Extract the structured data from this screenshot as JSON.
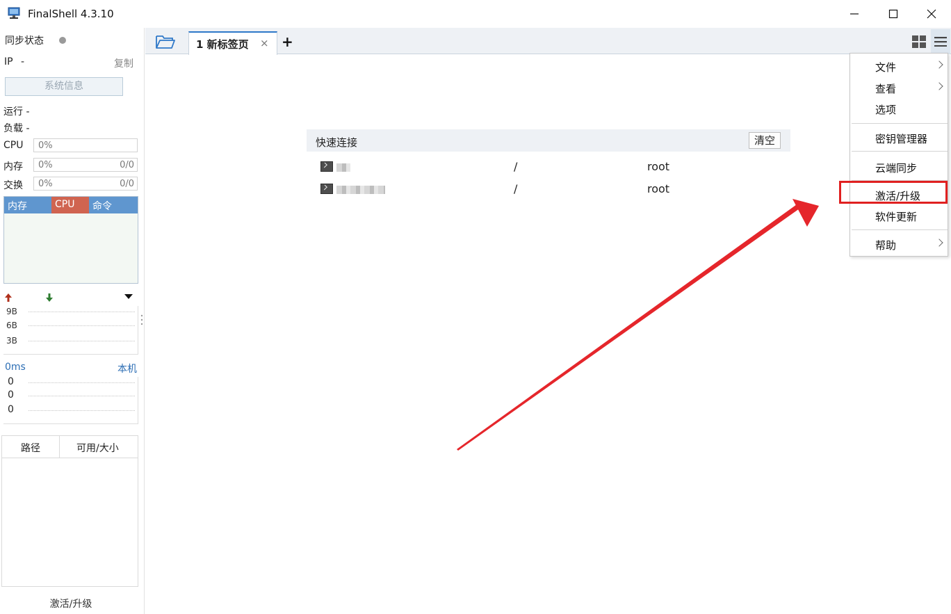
{
  "window": {
    "title": "FinalShell 4.3.10",
    "app_icon": "monitor-icon",
    "controls": [
      "minimize-icon",
      "maximize-icon",
      "close-icon"
    ]
  },
  "sidebar": {
    "sync_label": "同步状态",
    "ip_label": "IP",
    "ip_value": "-",
    "copy_label": "复制",
    "sysinfo_label": "系统信息",
    "run_label": "运行 -",
    "load_label": "负载 -",
    "cpu": {
      "label": "CPU",
      "pct": "0%"
    },
    "memory": {
      "label": "内存",
      "pct": "0%",
      "frac": "0/0"
    },
    "swap": {
      "label": "交换",
      "pct": "0%",
      "frac": "0/0"
    },
    "process_table": {
      "columns": [
        "内存",
        "CPU",
        "命令"
      ]
    },
    "network": {
      "ticks": [
        "9B",
        "6B",
        "3B"
      ],
      "icons": [
        "upload-arrow-icon",
        "download-arrow-icon",
        "dropdown-triangle-icon"
      ]
    },
    "ping": {
      "latency": "0ms",
      "target": "本机",
      "ticks": [
        "0",
        "0",
        "0"
      ]
    },
    "disk_table": {
      "columns": [
        "路径",
        "可用/大小"
      ]
    },
    "footer_activate": "激活/升级",
    "colors": {
      "proc_header": "#5f96cf",
      "proc_cpu": "#d06450",
      "link": "#2e6fb5"
    }
  },
  "tabbar": {
    "tabs": [
      {
        "label": "1 新标签页",
        "close": "×"
      }
    ],
    "add_label": "+",
    "icons": [
      "folder-open-icon",
      "grid-layout-icon",
      "hamburger-menu-icon"
    ]
  },
  "quick_connect": {
    "title": "快速连接",
    "clear_label": "清空",
    "rows": [
      {
        "path": "/",
        "user": "root"
      },
      {
        "path": "/",
        "user": "root"
      }
    ]
  },
  "menu": {
    "items": [
      {
        "label": "文件",
        "submenu": true
      },
      {
        "label": "查看",
        "submenu": true
      },
      {
        "label": "选项",
        "submenu": false
      },
      {
        "label": "密钥管理器",
        "submenu": false
      },
      {
        "label": "云端同步",
        "submenu": false
      },
      {
        "label": "激活/升级",
        "submenu": false
      },
      {
        "label": "软件更新",
        "submenu": false
      },
      {
        "label": "帮助",
        "submenu": true
      }
    ],
    "highlighted": "激活/升级",
    "highlight_color": "#e02020"
  }
}
